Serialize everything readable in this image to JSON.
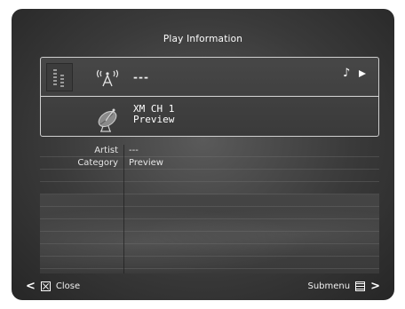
{
  "header": {
    "title": "Play Information"
  },
  "now_playing": {
    "status_text": "---",
    "channel_line": "XM CH 1",
    "channel_sub": "Preview",
    "icons": {
      "signal": "signal-level-icon",
      "antenna": "antenna-icon",
      "music": "music-note-icon",
      "play": "play-icon",
      "dish": "satellite-dish-icon"
    }
  },
  "info": {
    "rows": [
      {
        "label": "Artist",
        "value": "---"
      },
      {
        "label": "Category",
        "value": "Preview"
      }
    ]
  },
  "footer": {
    "close_label": "Close",
    "submenu_label": "Submenu"
  },
  "colors": {
    "background": "#3a3a3a",
    "text": "#f0f0f0",
    "border": "#cfcfcf"
  }
}
